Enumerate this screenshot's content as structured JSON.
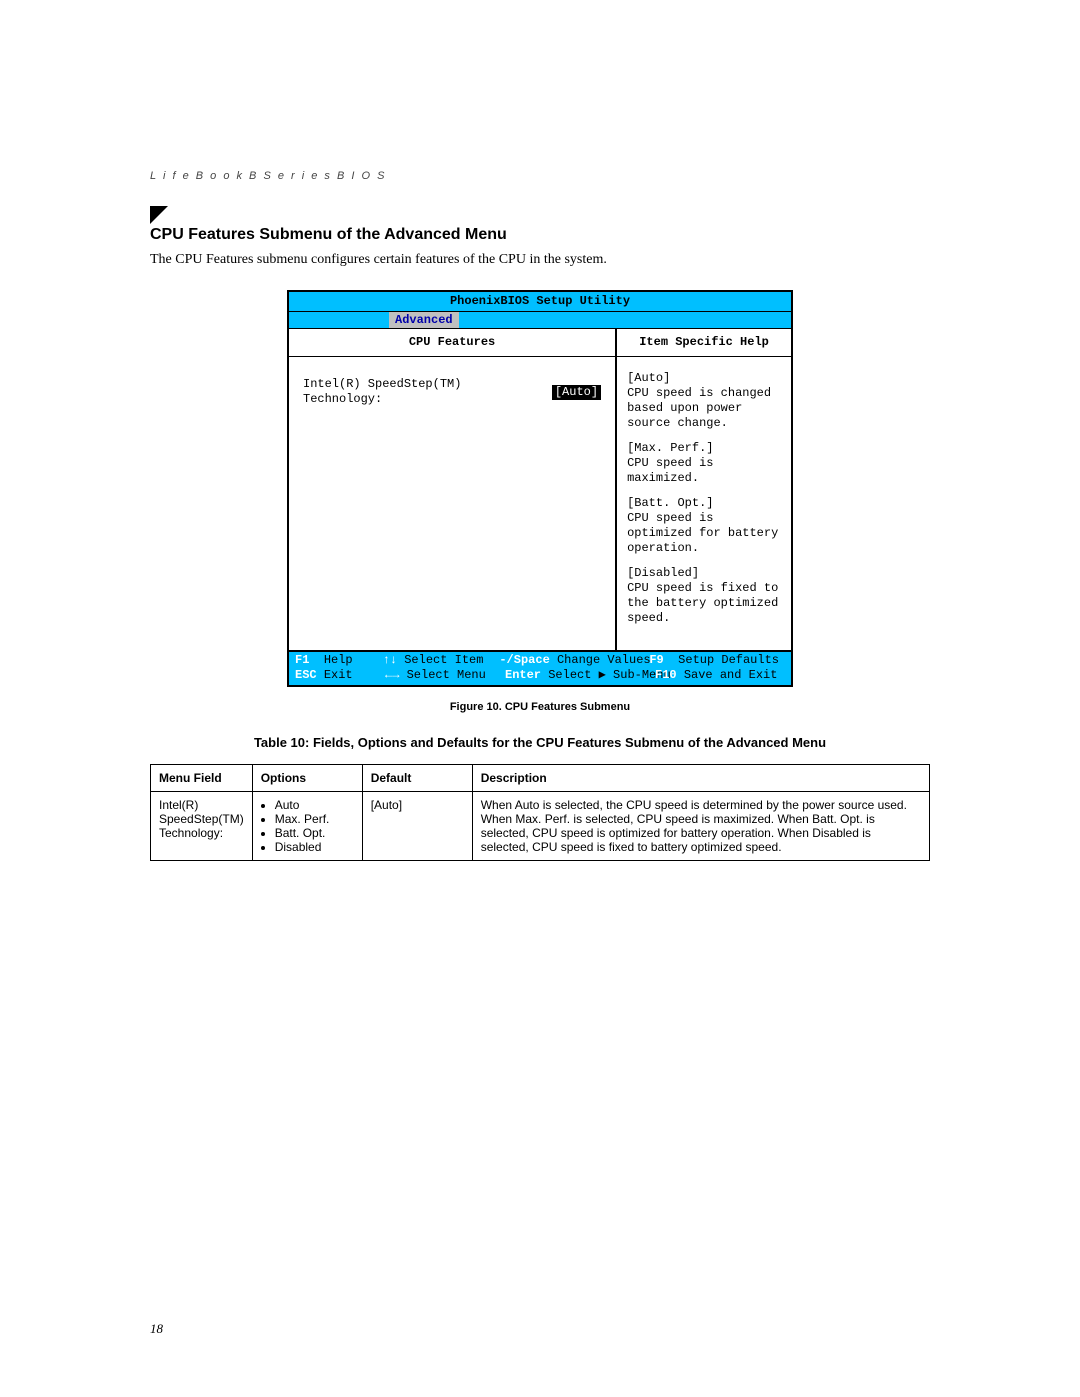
{
  "header": {
    "running": "L i f e B o o k   B   S e r i e s   B I O S"
  },
  "section": {
    "title": "CPU Features Submenu of the Advanced Menu",
    "intro": "The CPU Features submenu configures certain features of the CPU in the system."
  },
  "bios": {
    "title": "PhoenixBIOS Setup Utility",
    "active_tab": "Advanced",
    "left": {
      "subheader": "CPU Features",
      "field_label": "Intel(R) SpeedStep(TM) Technology:",
      "field_value": "[Auto]"
    },
    "right": {
      "subheader": "Item Specific Help",
      "h1": "[Auto]",
      "t1": "CPU speed is changed based upon power source change.",
      "h2": "[Max. Perf.]",
      "t2": "CPU speed is maximized.",
      "h3": "[Batt. Opt.]",
      "t3": "CPU speed is optimized for battery operation.",
      "h4": "[Disabled]",
      "t4": "CPU speed is fixed to the battery optimized speed."
    },
    "footer": {
      "r1k1": "F1",
      "r1t1": "Help",
      "r1k2": "↑↓",
      "r1t2": "Select Item",
      "r1k3": "-/Space",
      "r1t3": "Change Values",
      "r1k4": "F9",
      "r1t4": "Setup Defaults",
      "r2k1": "ESC",
      "r2t1": "Exit",
      "r2k2": "←→",
      "r2t2": "Select Menu",
      "r2k3": "Enter",
      "r2t3": "Select ▶ Sub-Menu",
      "r2k4": "F10",
      "r2t4": "Save and Exit"
    }
  },
  "figure_caption": "Figure 10.  CPU Features Submenu",
  "table_caption": "Table 10: Fields, Options and Defaults for the CPU Features Submenu of the Advanced Menu",
  "table": {
    "headers": {
      "menu": "Menu Field",
      "options": "Options",
      "default": "Default",
      "description": "Description"
    },
    "row": {
      "menu": "Intel(R) SpeedStep(TM) Technology:",
      "opts": [
        "Auto",
        "Max. Perf.",
        "Batt. Opt.",
        "Disabled"
      ],
      "default": "[Auto]",
      "description": "When Auto is selected, the CPU speed is determined by the power source used. When Max. Perf. is selected, CPU speed is maximized. When Batt. Opt. is selected, CPU speed is optimized for battery operation. When Disabled is selected, CPU speed is fixed to battery optimized speed."
    }
  },
  "page_number": "18"
}
